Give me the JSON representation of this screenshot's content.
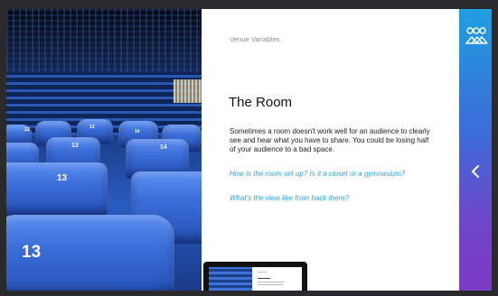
{
  "slide": {
    "eyebrow": "Venue Variables",
    "heading": "The Room",
    "body": "Sometimes a room doesn't work well for an audience to clearly see and hear what you have to share. You could be losing half of your audience to a bad space.",
    "links": [
      "How is the room set up? Is it a closet or a gymnasium?",
      "What's the view like from back there?"
    ]
  },
  "photo": {
    "seat_numbers": [
      "12",
      "13",
      "14",
      "13",
      "14",
      "13",
      "13"
    ]
  },
  "sidebar": {
    "logo_icon": "audience-group-icon",
    "nav_icon": "chevron-left-icon"
  },
  "colors": {
    "accent_top": "#1f9fe0",
    "accent_bottom": "#7d3ac4",
    "link": "#2fa0da",
    "seat_blue": "#3b6ed8"
  }
}
